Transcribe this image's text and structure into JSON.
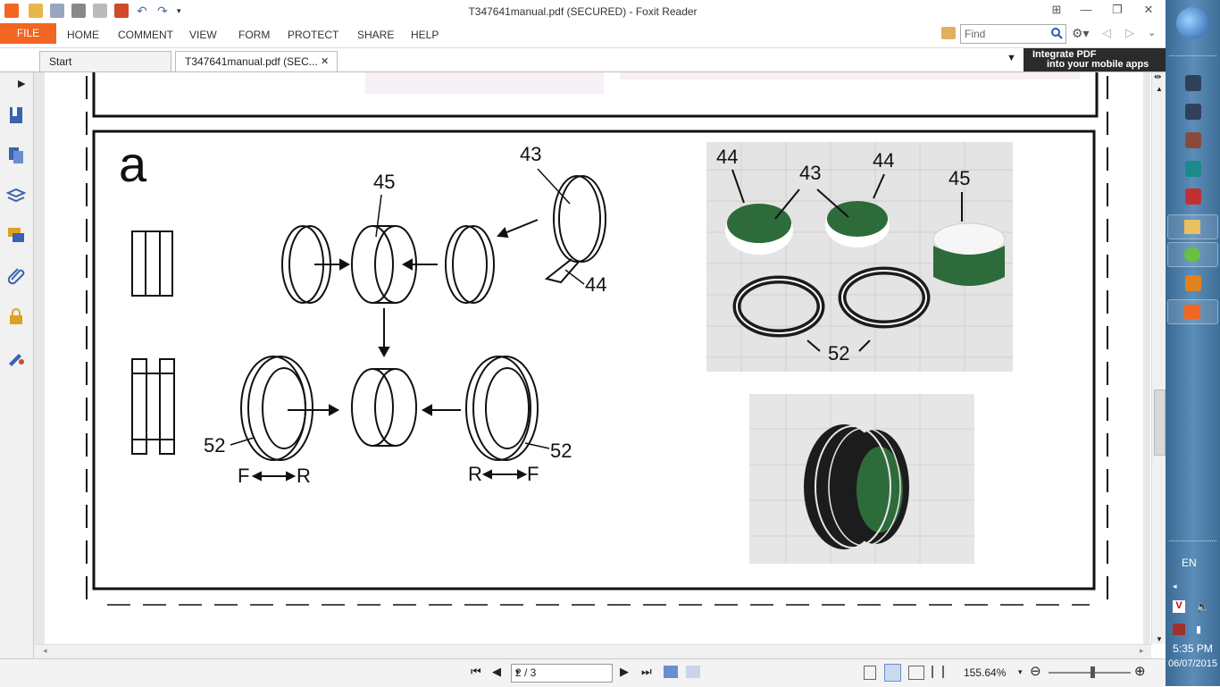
{
  "window": {
    "title": "T347641manual.pdf (SECURED) - Foxit Reader",
    "minimize_glyph": "—",
    "maximize_glyph": "❐",
    "close_glyph": "✕"
  },
  "ribbon": {
    "file_label": "FILE",
    "tabs": [
      "HOME",
      "COMMENT",
      "VIEW",
      "FORM",
      "PROTECT",
      "SHARE",
      "HELP"
    ],
    "find_placeholder": "Find"
  },
  "tabs": [
    {
      "label": "Start"
    },
    {
      "label": "T347641manual.pdf (SEC...",
      "close": "✕"
    }
  ],
  "banner": {
    "line1": "Integrate PDF",
    "line2": "into your mobile apps"
  },
  "diagram": {
    "panel_letter": "a",
    "labels": {
      "n43": "43",
      "n44": "44",
      "n45": "45",
      "n52_left": "52",
      "n52_right": "52",
      "f_left": "F",
      "r_left": "R",
      "r_right": "R",
      "f_right": "F"
    },
    "photo_top_labels": {
      "n44a": "44",
      "n43": "43",
      "n44b": "44",
      "n45": "45",
      "n52": "52"
    }
  },
  "statusbar": {
    "page_value": "2 / 3",
    "zoom": "155.64%"
  },
  "system": {
    "language": "EN",
    "time": "5:35 PM",
    "date": "06/07/2015"
  },
  "colors": {
    "file_tab": "#f26522",
    "taskbar": "#4a7aa6",
    "photo_green": "#2e6b3a"
  }
}
